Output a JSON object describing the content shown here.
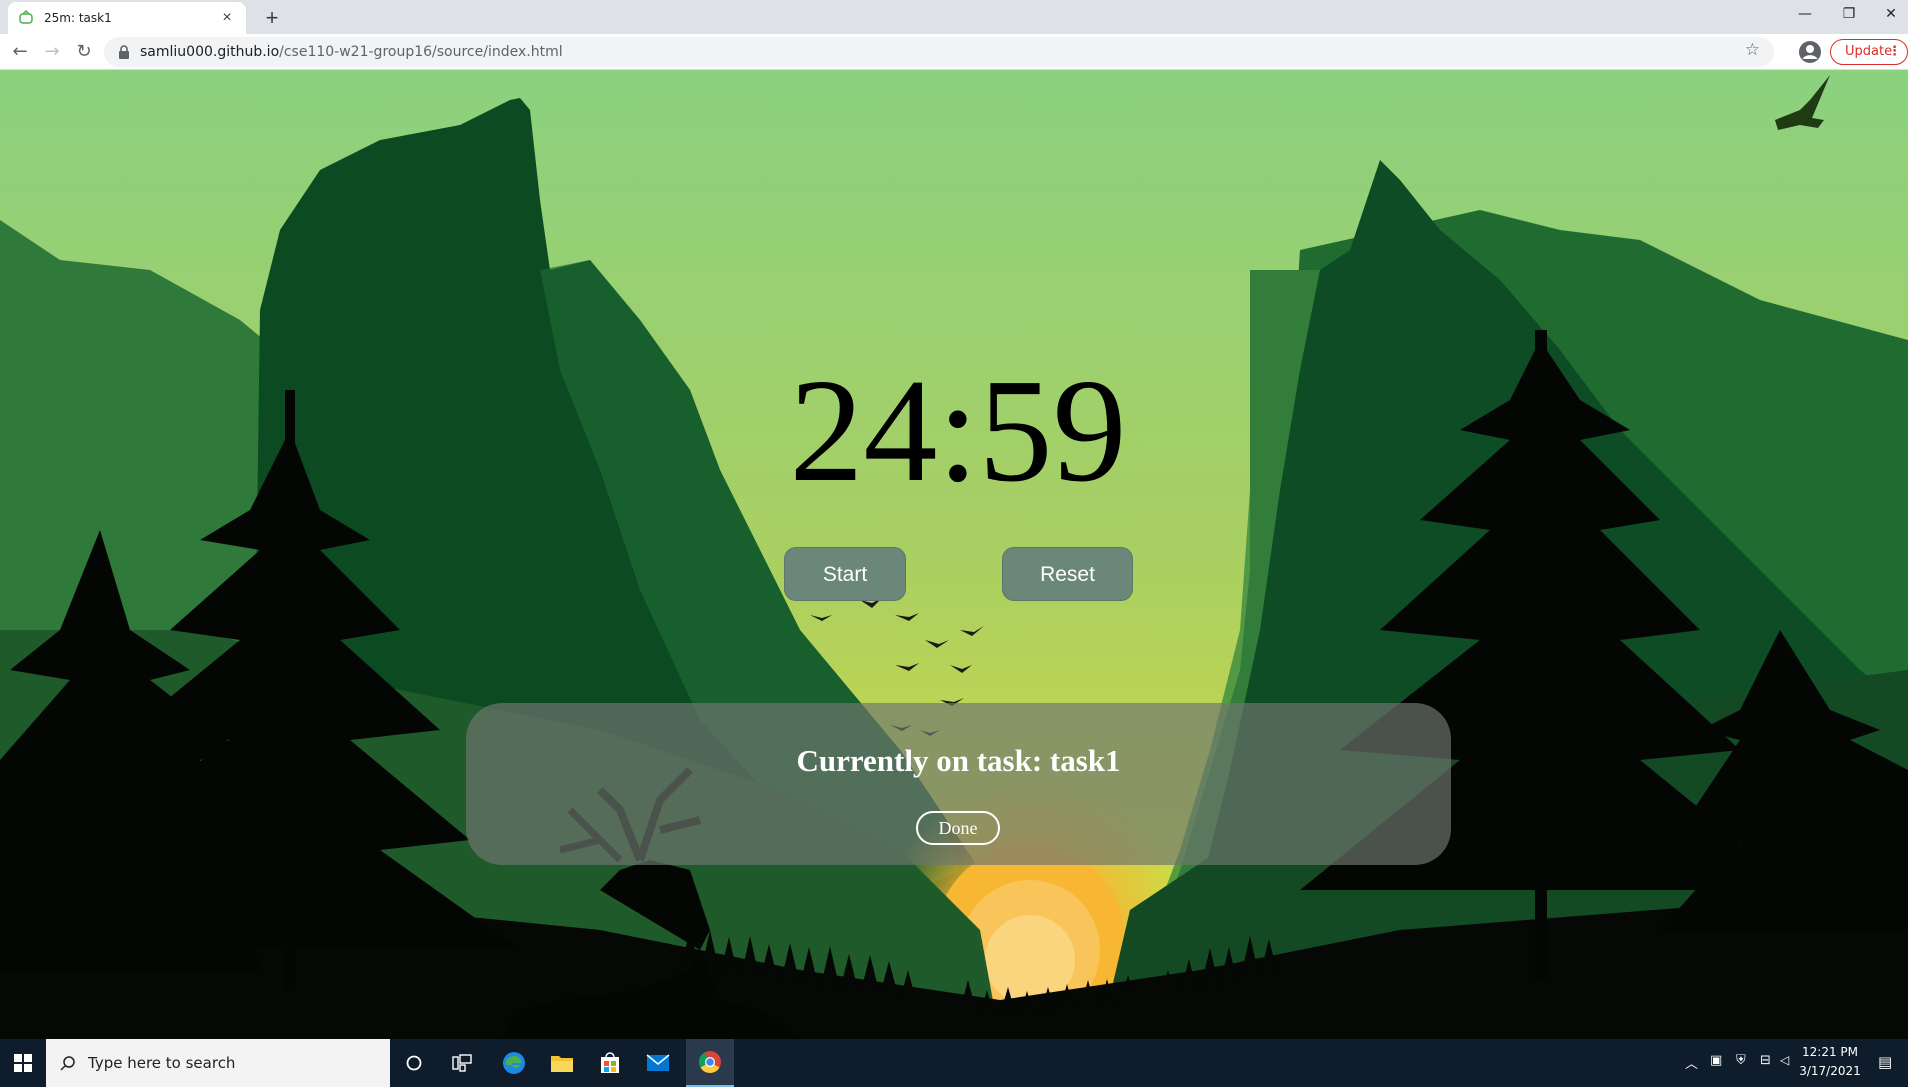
{
  "browser": {
    "tab_title": "25m: task1",
    "tab_close": "×",
    "new_tab": "+",
    "url_host": "samliu000.github.io",
    "url_path": "/cse110-w21-group16/source/index.html",
    "update_label": "Update",
    "window_controls": {
      "minimize": "—",
      "restore": "❐",
      "close": "✕"
    },
    "nav": {
      "back": "←",
      "forward": "→",
      "reload": "↻"
    },
    "star": "☆"
  },
  "page": {
    "timer": "24:59",
    "start_label": "Start",
    "reset_label": "Reset",
    "task_text": "Currently on task: task1",
    "done_label": "Done"
  },
  "taskbar": {
    "search_placeholder": "Type here to search",
    "time": "12:21 PM",
    "date": "3/17/2021",
    "apps": [
      "cortana-icon",
      "task-view-icon",
      "edge-icon",
      "file-explorer-icon",
      "store-icon",
      "mail-icon",
      "chrome-icon"
    ]
  },
  "colors": {
    "sky_top": "#8bd17f",
    "sky_bottom": "#c8d85a",
    "button_bg": "#6b8779",
    "panel_bg": "rgba(110,118,110,0.68)",
    "sun": "#f7b733"
  }
}
